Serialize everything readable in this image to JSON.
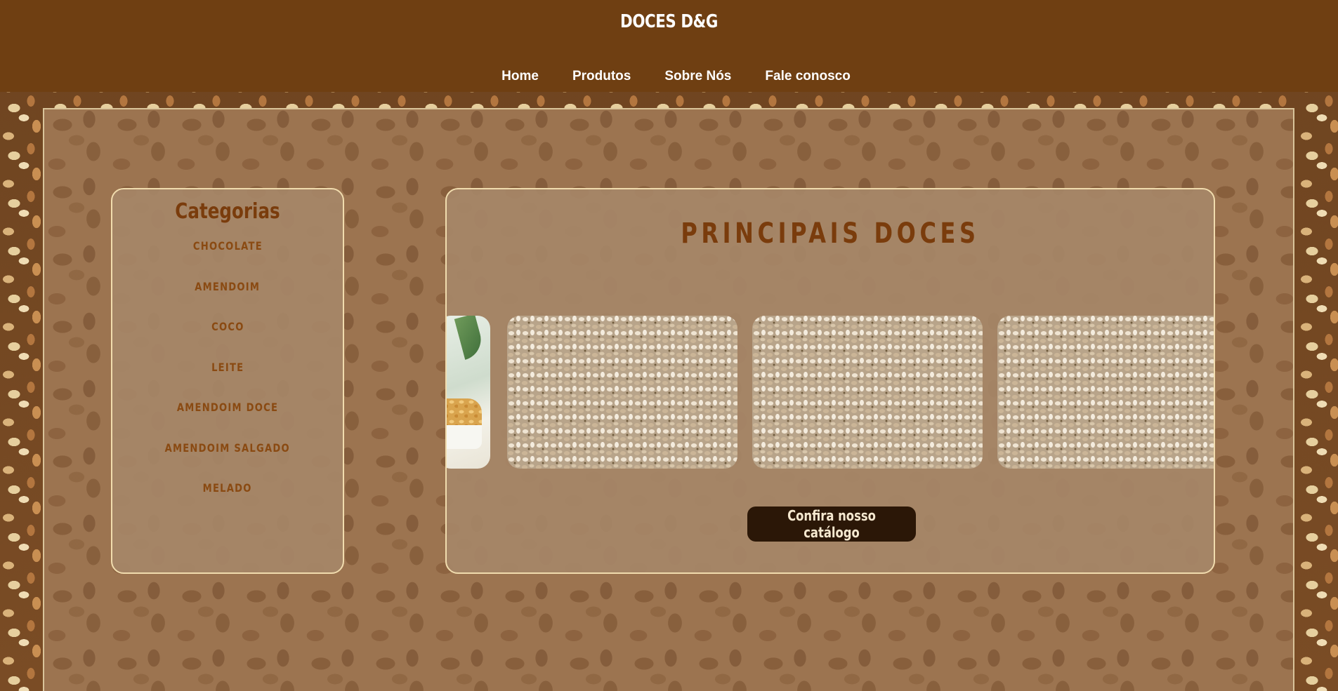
{
  "header": {
    "brand": "DOCES D&G",
    "nav": [
      {
        "label": "Home"
      },
      {
        "label": "Produtos"
      },
      {
        "label": "Sobre Nós"
      },
      {
        "label": "Fale conosco"
      }
    ]
  },
  "sidebar": {
    "title": "Categorias",
    "categories": [
      {
        "label": "CHOCOLATE"
      },
      {
        "label": "AMENDOIM"
      },
      {
        "label": "COCO"
      },
      {
        "label": "LEITE"
      },
      {
        "label": "AMENDOIM DOCE"
      },
      {
        "label": "AMENDOIM SALGADO"
      },
      {
        "label": "MELADO"
      }
    ]
  },
  "main": {
    "title": "PRINCIPAIS DOCES",
    "carousel": [
      {
        "image": "peanuts-in-bowl-photo"
      },
      {
        "image": "pistachios-photo"
      },
      {
        "image": "pistachios-photo"
      },
      {
        "image": "pistachios-photo"
      }
    ],
    "cta_label": "Confira nosso catálogo"
  },
  "colors": {
    "header_bg": "#6f3f12",
    "title_text": "#7a3c0c",
    "panel_border": "#f1dcae",
    "button_bg": "#2b1707",
    "button_text": "#f5e8cf"
  }
}
